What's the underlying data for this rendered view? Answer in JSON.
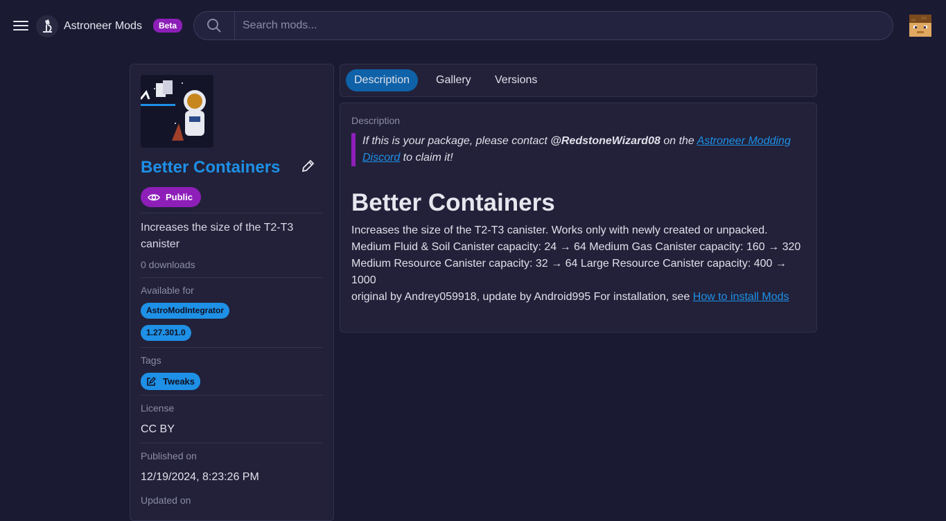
{
  "header": {
    "site_title": "Astroneer Mods",
    "beta_label": "Beta",
    "search_placeholder": "Search mods..."
  },
  "mod": {
    "name": "Better Containers",
    "visibility": "Public",
    "short_description": "Increases the size of the T2-T3 canister",
    "downloads": "0 downloads",
    "available_for_label": "Available for",
    "available_for": [
      "AstroModIntegrator",
      "1.27.301.0"
    ],
    "tags_label": "Tags",
    "tags": [
      "Tweaks"
    ],
    "license_label": "License",
    "license": "CC BY",
    "published_label": "Published on",
    "published": "12/19/2024, 8:23:26 PM",
    "updated_label": "Updated on"
  },
  "tabs": [
    "Description",
    "Gallery",
    "Versions"
  ],
  "description": {
    "label": "Description",
    "notice_prefix": "If this is your package, please contact ",
    "notice_user": "@RedstoneWizard08",
    "notice_mid": " on the ",
    "notice_link": "Astroneer Modding Discord",
    "notice_suffix": " to claim it!",
    "heading": "Better Containers",
    "paragraph1": "Increases the size of the T2-T3 canister. Works only with newly created or unpacked. Medium Fluid & Soil Canister capacity: 24 → 64 Medium Gas Canister capacity: 160 → 320 Medium Resource Canister capacity: 32 → 64 Large Resource Canister capacity: 400 → 1000",
    "paragraph2": "original by Andrey059918, update by Android995 For installation, see ",
    "install_link": "How to install Mods"
  },
  "colors": {
    "background": "#1b1a33",
    "panel": "#222139",
    "accent_blue": "#1e90e6",
    "accent_purple": "#8d1fb8"
  },
  "icons": [
    "menu-icon",
    "microscope-logo-icon",
    "search-icon",
    "avatar-icon",
    "pencil-icon",
    "eye-icon",
    "edit-tag-icon"
  ]
}
